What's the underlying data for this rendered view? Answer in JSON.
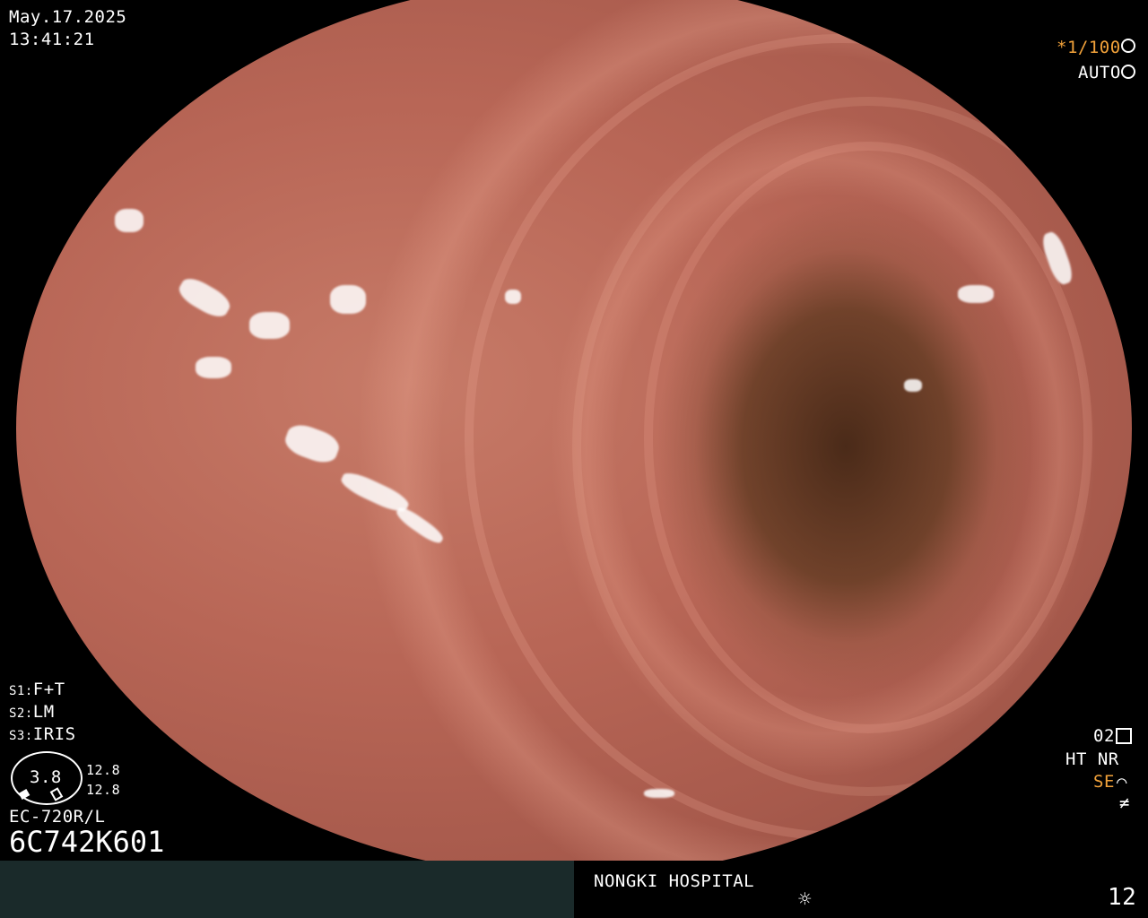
{
  "overlay": {
    "date": "May.17.2025",
    "time": "13:41:21",
    "shutter": "*1/100",
    "shutter_icon": "aperture-icon",
    "exposure": "AUTO",
    "exposure_icon": "iris-icon",
    "s1_key": "S1:",
    "s1_val": "F+T",
    "s2_key": "S2:",
    "s2_val": "LM",
    "s3_key": "S3:",
    "s3_val": "IRIS",
    "scope_value": "3.8",
    "scale_top": "12.8",
    "scale_bottom": "12.8",
    "model": "EC-720R/L",
    "serial": "6C742K601",
    "enhance": "02",
    "ht_nr": "HT NR",
    "se": "SE",
    "hospital": "NONGKI HOSPITAL",
    "frame_number": "12"
  },
  "colors": {
    "accent": "#f2a23a",
    "footer": "#1a2a2a"
  }
}
